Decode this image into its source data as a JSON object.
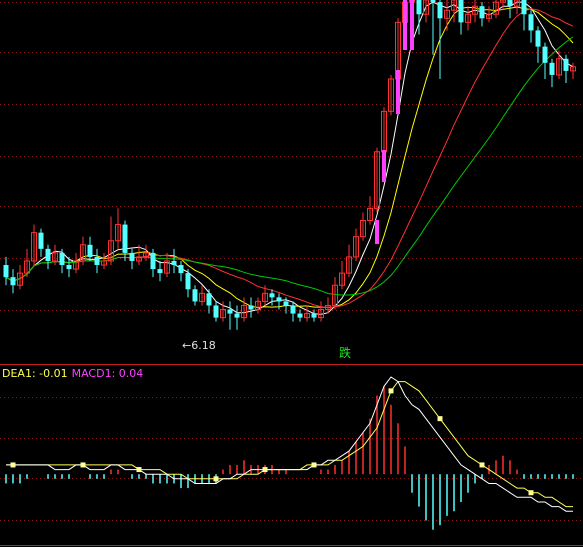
{
  "colors": {
    "background": "#000000",
    "grid": "#8a1a1a",
    "separator": "#c02020",
    "candle_up": "#ff3232",
    "candle_down": "#54ffff",
    "ma5": "#ffffff",
    "ma10": "#ffff00",
    "ma20": "#ff3030",
    "ma30": "#00c800",
    "macd_pos": "#ff3030",
    "macd_neg": "#54ffff",
    "dea": "#ffff55",
    "macd_line": "#ffffff",
    "volume_bar": "#ff40ff"
  },
  "price_panel": {
    "low_marker_text": "←6.18",
    "signal_text": "跌"
  },
  "indicator_panel": {
    "dea_label": "DEA1: -0.01",
    "macd_label": "MACD1: 0.04"
  },
  "chart_data": {
    "type": "candlestick",
    "ylim": [
      5.6,
      14.6
    ],
    "series_names": [],
    "candles": [
      [
        7.8,
        7.5,
        8.0,
        7.3
      ],
      [
        7.5,
        7.3,
        7.7,
        7.1
      ],
      [
        7.3,
        7.6,
        7.8,
        7.2
      ],
      [
        7.6,
        7.9,
        8.2,
        7.5
      ],
      [
        7.9,
        8.6,
        8.8,
        7.8
      ],
      [
        8.6,
        8.2,
        8.7,
        8.0
      ],
      [
        8.2,
        7.9,
        8.3,
        7.7
      ],
      [
        7.9,
        8.1,
        8.3,
        7.8
      ],
      [
        8.1,
        7.8,
        8.2,
        7.6
      ],
      [
        7.8,
        7.7,
        8.0,
        7.5
      ],
      [
        7.7,
        7.9,
        8.1,
        7.6
      ],
      [
        7.9,
        8.3,
        8.5,
        7.8
      ],
      [
        8.3,
        8.0,
        8.5,
        7.9
      ],
      [
        8.0,
        7.8,
        8.2,
        7.6
      ],
      [
        7.8,
        7.9,
        8.1,
        7.7
      ],
      [
        7.9,
        8.4,
        9.0,
        7.8
      ],
      [
        8.4,
        8.8,
        9.2,
        8.2
      ],
      [
        8.8,
        8.1,
        8.9,
        7.9
      ],
      [
        8.1,
        7.9,
        8.2,
        7.7
      ],
      [
        7.9,
        8.0,
        8.3,
        7.8
      ],
      [
        8.0,
        8.1,
        8.3,
        7.9
      ],
      [
        8.1,
        7.7,
        8.2,
        7.5
      ],
      [
        7.7,
        7.6,
        7.9,
        7.4
      ],
      [
        7.6,
        7.9,
        8.1,
        7.5
      ],
      [
        7.9,
        7.8,
        8.2,
        7.6
      ],
      [
        7.8,
        7.6,
        7.9,
        7.4
      ],
      [
        7.6,
        7.2,
        7.7,
        7.0
      ],
      [
        7.2,
        6.9,
        7.3,
        6.8
      ],
      [
        6.9,
        7.1,
        7.3,
        6.8
      ],
      [
        7.1,
        6.8,
        7.2,
        6.6
      ],
      [
        6.8,
        6.5,
        6.9,
        6.4
      ],
      [
        6.5,
        6.7,
        6.9,
        6.4
      ],
      [
        6.7,
        6.6,
        6.9,
        6.2
      ],
      [
        6.6,
        6.5,
        6.8,
        6.2
      ],
      [
        6.5,
        6.8,
        7.0,
        6.4
      ],
      [
        6.8,
        6.7,
        7.0,
        6.5
      ],
      [
        6.7,
        6.9,
        7.0,
        6.6
      ],
      [
        6.9,
        7.1,
        7.3,
        6.8
      ],
      [
        7.1,
        7.0,
        7.2,
        6.8
      ],
      [
        7.0,
        6.9,
        7.1,
        6.7
      ],
      [
        6.9,
        6.8,
        7.0,
        6.6
      ],
      [
        6.8,
        6.6,
        6.9,
        6.4
      ],
      [
        6.6,
        6.5,
        6.7,
        6.4
      ],
      [
        6.5,
        6.6,
        6.8,
        6.4
      ],
      [
        6.6,
        6.5,
        6.7,
        6.4
      ],
      [
        6.5,
        6.7,
        6.9,
        6.4
      ],
      [
        6.7,
        6.8,
        7.0,
        6.6
      ],
      [
        6.8,
        7.3,
        7.5,
        6.7
      ],
      [
        7.3,
        7.6,
        7.9,
        7.2
      ],
      [
        7.6,
        8.0,
        8.3,
        7.5
      ],
      [
        8.0,
        8.5,
        8.7,
        7.9
      ],
      [
        8.5,
        8.9,
        9.1,
        8.4
      ],
      [
        8.9,
        9.2,
        9.5,
        8.8
      ],
      [
        9.2,
        10.6,
        10.7,
        9.1
      ],
      [
        10.6,
        11.6,
        11.7,
        10.5
      ],
      [
        11.6,
        12.4,
        12.5,
        11.5
      ],
      [
        12.4,
        13.8,
        13.9,
        12.2
      ],
      [
        13.8,
        14.3,
        14.6,
        13.2
      ],
      [
        14.3,
        14.4,
        14.6,
        13.6
      ],
      [
        14.4,
        14.0,
        14.6,
        13.5
      ],
      [
        14.0,
        14.5,
        14.6,
        13.8
      ],
      [
        14.5,
        14.3,
        14.6,
        13.0
      ],
      [
        14.3,
        13.9,
        14.4,
        12.4
      ],
      [
        13.9,
        14.1,
        14.5,
        13.6
      ],
      [
        14.1,
        14.4,
        14.6,
        13.8
      ],
      [
        14.4,
        13.8,
        14.5,
        13.5
      ],
      [
        13.8,
        14.0,
        14.2,
        13.6
      ],
      [
        14.0,
        14.2,
        14.4,
        13.8
      ],
      [
        14.2,
        13.9,
        14.3,
        13.7
      ],
      [
        13.9,
        14.0,
        14.2,
        13.8
      ],
      [
        14.0,
        14.3,
        14.5,
        13.9
      ],
      [
        14.3,
        14.6,
        14.6,
        14.1
      ],
      [
        14.6,
        14.2,
        14.6,
        13.9
      ],
      [
        14.2,
        14.4,
        14.6,
        14.0
      ],
      [
        14.4,
        14.0,
        14.5,
        13.6
      ],
      [
        14.0,
        13.6,
        14.1,
        13.3
      ],
      [
        13.6,
        13.2,
        13.7,
        12.8
      ],
      [
        13.2,
        12.8,
        13.3,
        12.4
      ],
      [
        12.8,
        12.5,
        12.9,
        12.2
      ],
      [
        12.5,
        12.9,
        13.1,
        12.4
      ],
      [
        12.9,
        12.6,
        13.0,
        12.3
      ],
      [
        12.6,
        12.7,
        12.8,
        12.4
      ]
    ],
    "volume_marks": [
      [
        4,
        0.0
      ],
      [
        53,
        0.35
      ],
      [
        54,
        0.55
      ],
      [
        56,
        0.85
      ],
      [
        57,
        1.0
      ],
      [
        58,
        1.0
      ]
    ],
    "macd_ylim": [
      -0.14,
      0.21
    ],
    "macd_hist": [
      -0.02,
      -0.02,
      -0.02,
      -0.01,
      0.0,
      0.0,
      -0.01,
      -0.01,
      -0.01,
      -0.01,
      0.0,
      0.0,
      -0.01,
      -0.01,
      -0.01,
      0.01,
      0.01,
      0.0,
      -0.01,
      -0.01,
      -0.01,
      -0.02,
      -0.02,
      -0.02,
      -0.02,
      -0.03,
      -0.03,
      -0.02,
      -0.02,
      -0.02,
      -0.02,
      0.01,
      0.02,
      0.02,
      0.03,
      0.02,
      0.02,
      0.02,
      0.02,
      0.01,
      0.01,
      0.0,
      0.0,
      0.0,
      0.0,
      0.01,
      0.01,
      0.02,
      0.03,
      0.05,
      0.07,
      0.09,
      0.12,
      0.17,
      0.19,
      0.15,
      0.11,
      0.06,
      -0.04,
      -0.07,
      -0.1,
      -0.12,
      -0.11,
      -0.09,
      -0.08,
      -0.06,
      -0.04,
      -0.02,
      -0.01,
      0.02,
      0.03,
      0.04,
      0.03,
      0.01,
      -0.01,
      -0.01,
      -0.01,
      -0.01,
      -0.01,
      -0.01,
      -0.01,
      -0.01
    ],
    "dea": [
      0.02,
      0.02,
      0.02,
      0.02,
      0.02,
      0.02,
      0.02,
      0.02,
      0.02,
      0.02,
      0.02,
      0.02,
      0.02,
      0.02,
      0.02,
      0.02,
      0.02,
      0.02,
      0.02,
      0.01,
      0.01,
      0.01,
      0.01,
      0.0,
      0.0,
      0.0,
      -0.01,
      -0.01,
      -0.01,
      -0.01,
      -0.01,
      -0.01,
      -0.01,
      -0.01,
      0.0,
      0.0,
      0.0,
      0.01,
      0.01,
      0.01,
      0.01,
      0.01,
      0.01,
      0.02,
      0.02,
      0.02,
      0.02,
      0.03,
      0.03,
      0.04,
      0.05,
      0.06,
      0.08,
      0.1,
      0.14,
      0.18,
      0.2,
      0.2,
      0.19,
      0.18,
      0.16,
      0.14,
      0.12,
      0.1,
      0.08,
      0.06,
      0.04,
      0.03,
      0.02,
      0.01,
      0.0,
      -0.01,
      -0.02,
      -0.03,
      -0.03,
      -0.04,
      -0.04,
      -0.05,
      -0.05,
      -0.06,
      -0.07,
      -0.07
    ],
    "macd_line": [
      0.02,
      0.02,
      0.02,
      0.02,
      0.02,
      0.02,
      0.02,
      0.01,
      0.01,
      0.01,
      0.02,
      0.02,
      0.01,
      0.01,
      0.01,
      0.02,
      0.02,
      0.01,
      0.01,
      0.01,
      0.0,
      0.0,
      0.0,
      0.0,
      -0.01,
      -0.01,
      -0.01,
      -0.02,
      -0.02,
      -0.02,
      -0.02,
      -0.01,
      -0.01,
      0.0,
      0.0,
      0.01,
      0.01,
      0.01,
      0.01,
      0.01,
      0.01,
      0.01,
      0.01,
      0.01,
      0.02,
      0.02,
      0.03,
      0.03,
      0.04,
      0.05,
      0.07,
      0.09,
      0.11,
      0.15,
      0.19,
      0.21,
      0.2,
      0.17,
      0.15,
      0.14,
      0.12,
      0.1,
      0.08,
      0.06,
      0.04,
      0.02,
      0.01,
      0.0,
      -0.01,
      -0.02,
      -0.02,
      -0.03,
      -0.04,
      -0.05,
      -0.05,
      -0.05,
      -0.06,
      -0.06,
      -0.07,
      -0.07,
      -0.08,
      -0.08
    ],
    "dea_markers": [
      1,
      11,
      19,
      30,
      37,
      44,
      55,
      62,
      68,
      75
    ],
    "low_value": 6.18
  }
}
